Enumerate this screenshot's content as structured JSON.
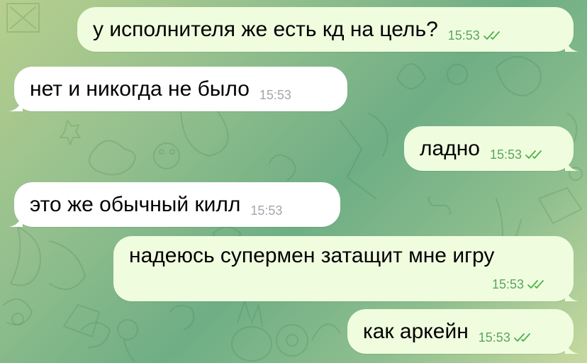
{
  "colors": {
    "outgoing_bubble": "#effdde",
    "incoming_bubble": "#ffffff",
    "outgoing_time": "#5aa65f",
    "incoming_time": "#a1a7ad",
    "read_check": "#4fae4e"
  },
  "messages": [
    {
      "direction": "out",
      "text": "у исполнителя же есть кд на цель?",
      "time": "15:53",
      "status": "read",
      "status_icon": "double-check-icon"
    },
    {
      "direction": "in",
      "text": "нет и никогда не было",
      "time": "15:53"
    },
    {
      "direction": "out",
      "text": "ладно",
      "time": "15:53",
      "status": "read",
      "status_icon": "double-check-icon"
    },
    {
      "direction": "in",
      "text": "это же обычный килл",
      "time": "15:53"
    },
    {
      "direction": "out",
      "text": "надеюсь супермен затащит мне игру",
      "time": "15:53",
      "status": "read",
      "status_icon": "double-check-icon"
    },
    {
      "direction": "out",
      "text": "как аркейн",
      "time": "15:53",
      "status": "read",
      "status_icon": "double-check-icon"
    }
  ]
}
